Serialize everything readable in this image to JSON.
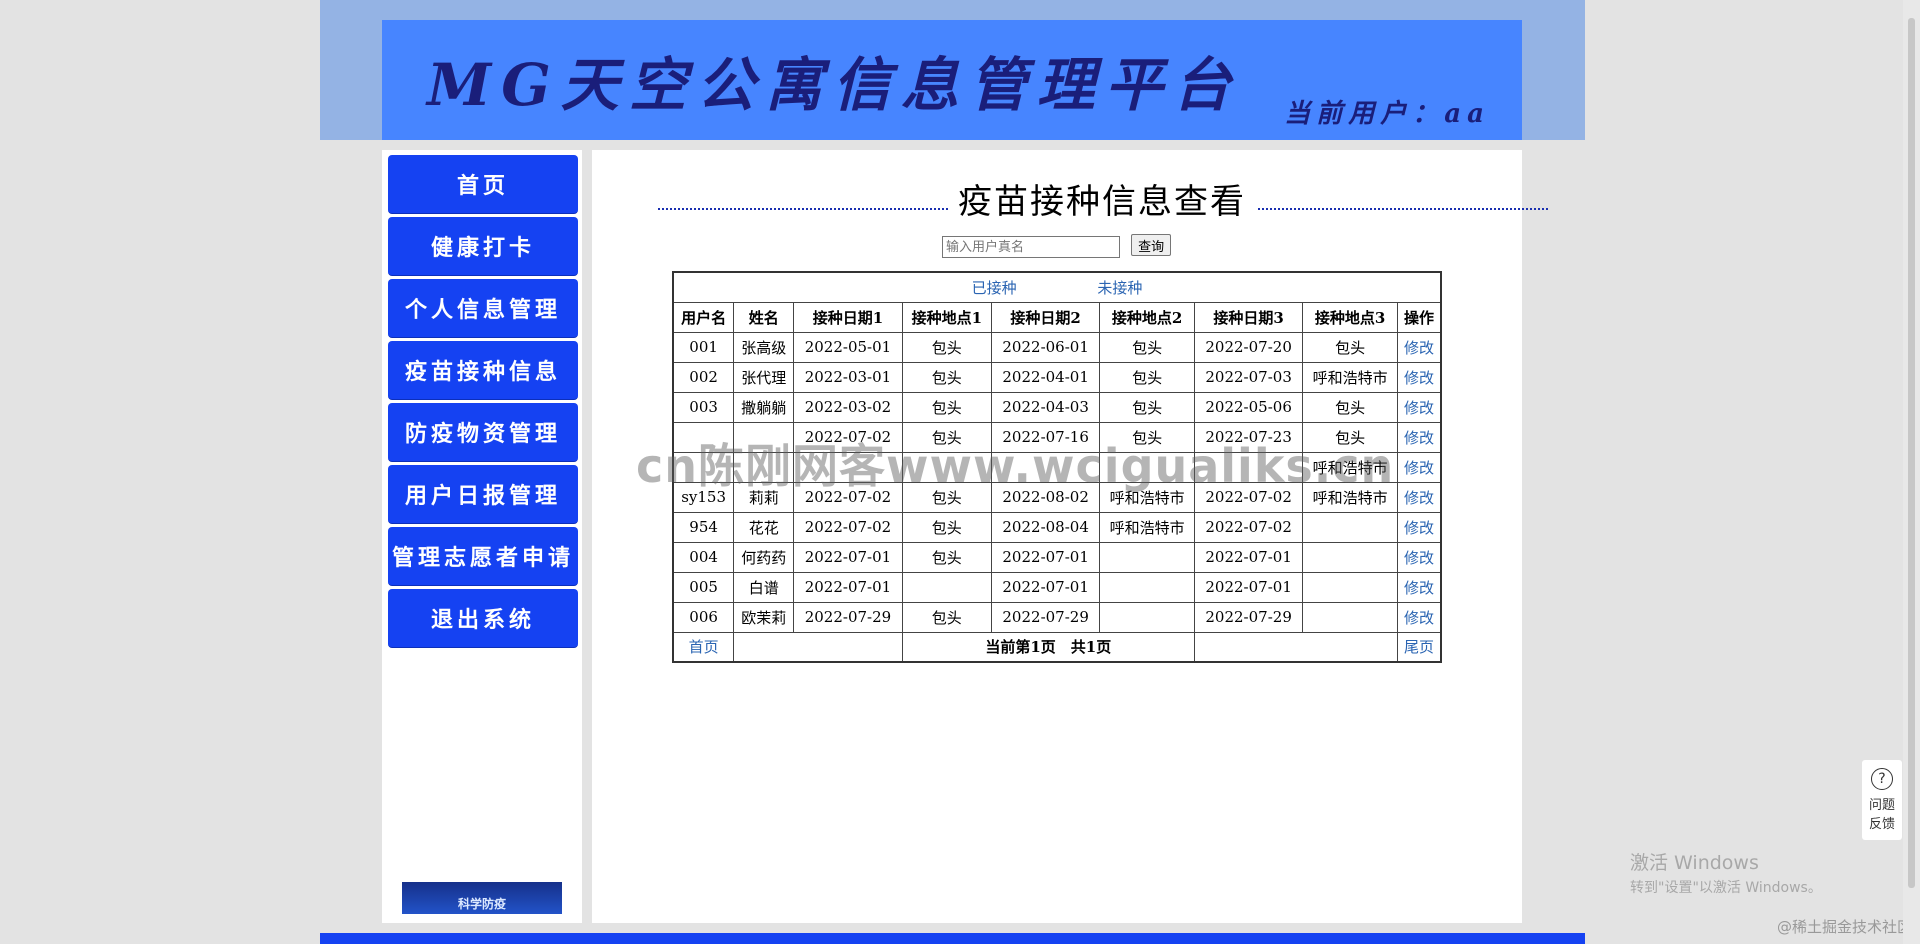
{
  "header": {
    "brand": "MG天空公寓信息管理平台",
    "user_label": "当前用户：",
    "user_name": "aa"
  },
  "sidebar": {
    "items": [
      {
        "label": "首页"
      },
      {
        "label": "健康打卡"
      },
      {
        "label": "个人信息管理"
      },
      {
        "label": "疫苗接种信息"
      },
      {
        "label": "防疫物资管理"
      },
      {
        "label": "用户日报管理"
      },
      {
        "label": "管理志愿者申请"
      },
      {
        "label": "退出系统"
      }
    ],
    "promo_text": "科学防疫"
  },
  "main": {
    "title": "疫苗接种信息查看",
    "search": {
      "placeholder": "输入用户真名",
      "button": "查询"
    },
    "filters": {
      "vaccinated": "已接种",
      "not_vaccinated": "未接种"
    },
    "columns": [
      "用户名",
      "姓名",
      "接种日期1",
      "接种地点1",
      "接种日期2",
      "接种地点2",
      "接种日期3",
      "接种地点3",
      "操作"
    ],
    "rows": [
      {
        "username": "001",
        "name": "张高级",
        "d1": "2022-05-01",
        "p1": "包头",
        "d2": "2022-06-01",
        "p2": "包头",
        "d3": "2022-07-20",
        "p3": "包头",
        "op": "修改"
      },
      {
        "username": "002",
        "name": "张代理",
        "d1": "2022-03-01",
        "p1": "包头",
        "d2": "2022-04-01",
        "p2": "包头",
        "d3": "2022-07-03",
        "p3": "呼和浩特市",
        "op": "修改"
      },
      {
        "username": "003",
        "name": "撒躺躺",
        "d1": "2022-03-02",
        "p1": "包头",
        "d2": "2022-04-03",
        "p2": "包头",
        "d3": "2022-05-06",
        "p3": "包头",
        "op": "修改"
      },
      {
        "username": "",
        "name": "",
        "d1": "2022-07-02",
        "p1": "包头",
        "d2": "2022-07-16",
        "p2": "包头",
        "d3": "2022-07-23",
        "p3": "包头",
        "op": "修改"
      },
      {
        "username": "",
        "name": "",
        "d1": "",
        "p1": "",
        "d2": "",
        "p2": "",
        "d3": "",
        "p3": "呼和浩特市",
        "op": "修改"
      },
      {
        "username": "sy153",
        "name": "莉莉",
        "d1": "2022-07-02",
        "p1": "包头",
        "d2": "2022-08-02",
        "p2": "呼和浩特市",
        "d3": "2022-07-02",
        "p3": "呼和浩特市",
        "op": "修改"
      },
      {
        "username": "954",
        "name": "花花",
        "d1": "2022-07-02",
        "p1": "包头",
        "d2": "2022-08-04",
        "p2": "呼和浩特市",
        "d3": "2022-07-02",
        "p3": "",
        "op": "修改"
      },
      {
        "username": "004",
        "name": "何药药",
        "d1": "2022-07-01",
        "p1": "包头",
        "d2": "2022-07-01",
        "p2": "",
        "d3": "2022-07-01",
        "p3": "",
        "op": "修改"
      },
      {
        "username": "005",
        "name": "白谱",
        "d1": "2022-07-01",
        "p1": "",
        "d2": "2022-07-01",
        "p2": "",
        "d3": "2022-07-01",
        "p3": "",
        "op": "修改"
      },
      {
        "username": "006",
        "name": "欧茉莉",
        "d1": "2022-07-29",
        "p1": "包头",
        "d2": "2022-07-29",
        "p2": "",
        "d3": "2022-07-29",
        "p3": "",
        "op": "修改"
      }
    ],
    "pager": {
      "first": "首页",
      "info": "当前第1页　共1页",
      "last": "尾页"
    }
  },
  "overlay": {
    "watermark": "cn陈刚网客www.wcigualiks.cn",
    "feedback_icon": "question-icon",
    "feedback_1": "问题",
    "feedback_2": "反馈",
    "activate_1": "激活 Windows",
    "activate_2": "转到\"设置\"以激活 Windows。",
    "credit": "@稀土掘金技术社区"
  }
}
